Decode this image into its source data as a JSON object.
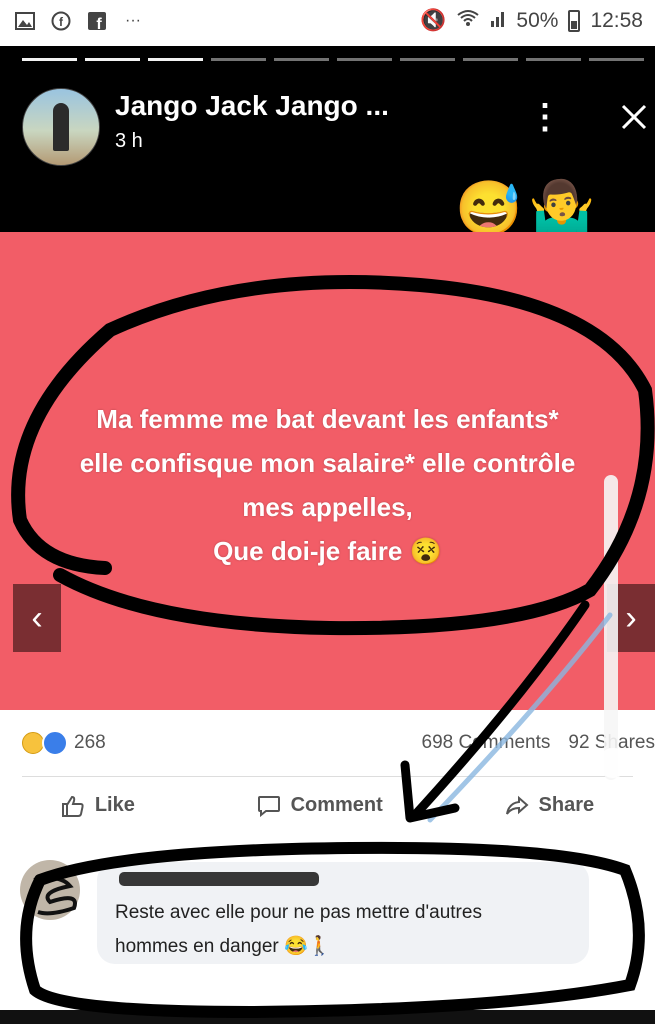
{
  "status_bar": {
    "battery": "50%",
    "clock": "12:58",
    "left_icons": [
      "gallery-icon",
      "facebook-messenger-icon",
      "facebook-icon",
      "more-dots-icon"
    ],
    "right_icons": [
      "mute-icon",
      "wifi-icon",
      "signal-icon",
      "battery-icon"
    ]
  },
  "story": {
    "author": "Jango Jack Jango ...",
    "time": "3 h",
    "emojis": [
      "😅",
      "🤷‍♂️"
    ]
  },
  "post": {
    "background_color": "#f25d67",
    "lines": [
      "Ma femme me bat devant les enfants*",
      "elle confisque mon salaire* elle contrôle",
      "mes appelles,",
      "Que doi-je faire 😵"
    ]
  },
  "engagement": {
    "reaction_count": "268",
    "comments": "698 Comments",
    "shares": "92 Shares"
  },
  "actions": {
    "like": "Like",
    "comment": "Comment",
    "share": "Share"
  },
  "comment": {
    "line1": "Reste avec elle pour ne pas mettre d'autres",
    "line2": "hommes en danger 😂🚶"
  }
}
